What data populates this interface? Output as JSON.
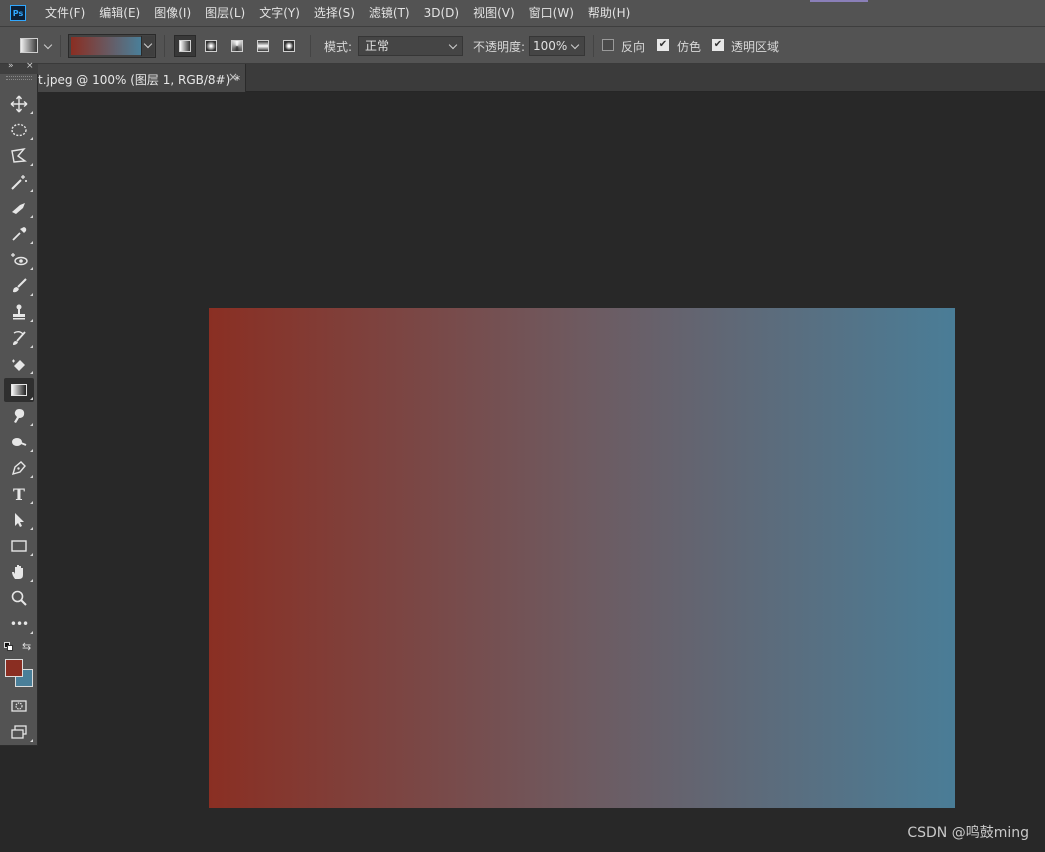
{
  "app": {
    "logo_text": "Ps"
  },
  "menu": [
    {
      "label": "文件(F)"
    },
    {
      "label": "编辑(E)"
    },
    {
      "label": "图像(I)"
    },
    {
      "label": "图层(L)"
    },
    {
      "label": "文字(Y)"
    },
    {
      "label": "选择(S)"
    },
    {
      "label": "滤镜(T)"
    },
    {
      "label": "3D(D)"
    },
    {
      "label": "视图(V)"
    },
    {
      "label": "窗口(W)"
    },
    {
      "label": "帮助(H)"
    }
  ],
  "options": {
    "gradient_start": "#8a2e22",
    "gradient_end": "#4a7f99",
    "mode_label": "模式:",
    "mode_value": "正常",
    "opacity_label": "不透明度:",
    "opacity_value": "100%",
    "reverse_label": "反向",
    "reverse_checked": false,
    "dither_label": "仿色",
    "dither_checked": true,
    "transparency_label": "透明区域",
    "transparency_checked": true
  },
  "document": {
    "tab_title": "t.jpeg @ 100% (图层 1, RGB/8#) *",
    "tab_close": "×",
    "canvas_gradient_start": "#8a2f23",
    "canvas_gradient_mid": "#6e5a60",
    "canvas_gradient_end": "#4a7d97"
  },
  "tools": [
    {
      "name": "move-icon"
    },
    {
      "name": "elliptical-marquee-icon"
    },
    {
      "name": "polygonal-lasso-icon"
    },
    {
      "name": "magic-wand-icon"
    },
    {
      "name": "crop-icon"
    },
    {
      "name": "eyedropper-icon"
    },
    {
      "name": "red-eye-icon"
    },
    {
      "name": "brush-icon"
    },
    {
      "name": "clone-stamp-icon"
    },
    {
      "name": "history-brush-icon"
    },
    {
      "name": "eraser-icon"
    },
    {
      "name": "gradient-icon"
    },
    {
      "name": "blur-icon"
    },
    {
      "name": "dodge-icon"
    },
    {
      "name": "pen-icon"
    },
    {
      "name": "type-icon",
      "glyph": "T"
    },
    {
      "name": "path-selection-icon"
    },
    {
      "name": "rectangle-icon"
    },
    {
      "name": "hand-icon"
    },
    {
      "name": "zoom-icon"
    },
    {
      "name": "more-tools-icon",
      "glyph": "•••"
    }
  ],
  "colors": {
    "foreground": "#8a2e22",
    "background": "#4a7f99"
  },
  "watermark": "CSDN @鸣鼓ming"
}
